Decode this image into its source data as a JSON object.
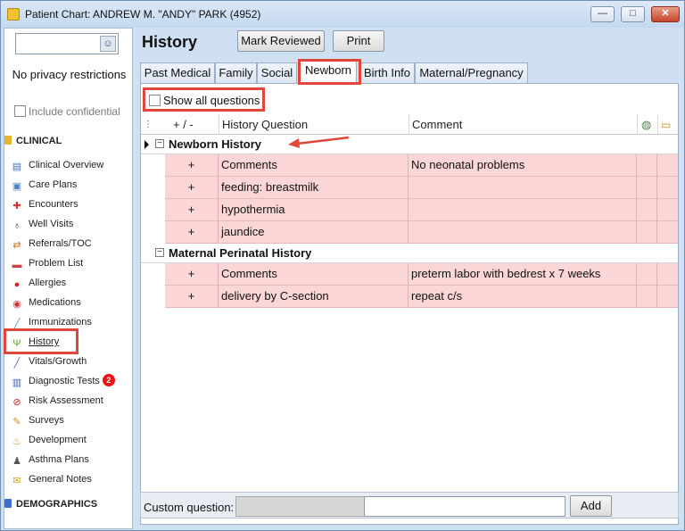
{
  "window": {
    "title": "Patient Chart: ANDREW M. \"ANDY\" PARK (4952)",
    "controls": {
      "minimize": "—",
      "maximize": "□",
      "close": "✕"
    }
  },
  "sidebar": {
    "privacy_text": "No privacy restrictions",
    "include_confidential": "Include confidential",
    "clinical_header": "CLINICAL",
    "demographics_header": "DEMOGRAPHICS",
    "items": [
      {
        "label": "Clinical Overview",
        "icon": "overview-icon",
        "glyph": "▤",
        "color": "#3a6fb0"
      },
      {
        "label": "Care Plans",
        "icon": "care-plans-icon",
        "glyph": "▣",
        "color": "#4b7fc0"
      },
      {
        "label": "Encounters",
        "icon": "encounters-icon",
        "glyph": "✚",
        "color": "#d33"
      },
      {
        "label": "Well Visits",
        "icon": "stethoscope-icon",
        "glyph": "♁",
        "color": "#333"
      },
      {
        "label": "Referrals/TOC",
        "icon": "referrals-icon",
        "glyph": "⇄",
        "color": "#c8782a"
      },
      {
        "label": "Problem List",
        "icon": "problem-list-icon",
        "glyph": "▬",
        "color": "#c44"
      },
      {
        "label": "Allergies",
        "icon": "allergies-icon",
        "glyph": "●",
        "color": "#d22"
      },
      {
        "label": "Medications",
        "icon": "medications-icon",
        "glyph": "◉",
        "color": "#c33"
      },
      {
        "label": "Immunizations",
        "icon": "syringe-icon",
        "glyph": "╱",
        "color": "#7a9cc0"
      },
      {
        "label": "History",
        "icon": "family-tree-icon",
        "glyph": "Ψ",
        "color": "#5a9a2a",
        "selected": true
      },
      {
        "label": "Vitals/Growth",
        "icon": "vitals-icon",
        "glyph": "╱",
        "color": "#7a4fb0"
      },
      {
        "label": "Diagnostic Tests",
        "icon": "test-tubes-icon",
        "glyph": "▥",
        "color": "#3a5fc0",
        "badge": "2"
      },
      {
        "label": "Risk Assessment",
        "icon": "no-smoking-icon",
        "glyph": "⊘",
        "color": "#d22"
      },
      {
        "label": "Surveys",
        "icon": "surveys-icon",
        "glyph": "✎",
        "color": "#c8902a"
      },
      {
        "label": "Development",
        "icon": "development-icon",
        "glyph": "♨",
        "color": "#c8902a"
      },
      {
        "label": "Asthma Plans",
        "icon": "asthma-plans-icon",
        "glyph": "♟",
        "color": "#555"
      },
      {
        "label": "General Notes",
        "icon": "general-notes-icon",
        "glyph": "✉",
        "color": "#d8a020"
      }
    ]
  },
  "main": {
    "page_title": "History",
    "buttons": {
      "mark_reviewed": "Mark Reviewed",
      "print": "Print"
    },
    "tabs": [
      "Past Medical",
      "Family",
      "Social",
      "Newborn",
      "Birth Info",
      "Maternal/Pregnancy"
    ],
    "active_tab": "Newborn",
    "show_all_questions": "Show all questions",
    "columns": {
      "plus_minus": "+ / -",
      "question": "History Question",
      "comment": "Comment"
    },
    "groups": [
      {
        "title": "Newborn History",
        "rows": [
          {
            "plus": "+",
            "question": "Comments",
            "comment": "No neonatal problems"
          },
          {
            "plus": "+",
            "question": "feeding: breastmilk",
            "comment": ""
          },
          {
            "plus": "+",
            "question": "hypothermia",
            "comment": ""
          },
          {
            "plus": "+",
            "question": "jaundice",
            "comment": ""
          }
        ]
      },
      {
        "title": "Maternal Perinatal History",
        "rows": [
          {
            "plus": "+",
            "question": "Comments",
            "comment": "preterm labor with bedrest x 7 weeks"
          },
          {
            "plus": "+",
            "question": "delivery by C-section",
            "comment": "repeat c/s"
          }
        ]
      }
    ],
    "custom_question_label": "Custom question:",
    "add_button": "Add"
  },
  "colors": {
    "row_highlight": "#fbd6d6",
    "annotation_red": "#e0463a",
    "window_bg": "#cfe0f3"
  }
}
